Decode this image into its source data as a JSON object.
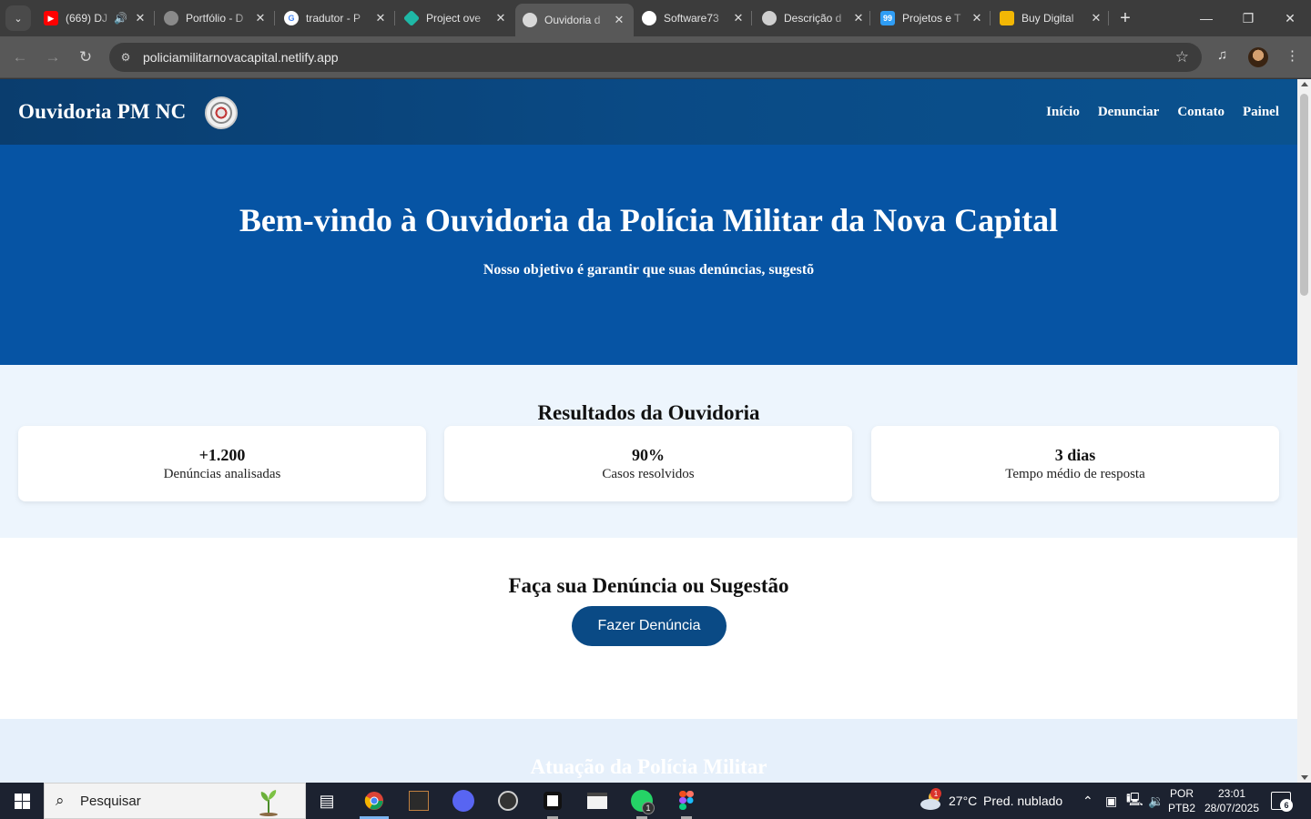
{
  "browser": {
    "tabs": [
      {
        "title": "(669) DJ",
        "favicon": "youtube-icon",
        "color": "#ff0000",
        "audio": true
      },
      {
        "title": "Portfólio - D",
        "favicon": "globe-icon",
        "color": "#8a8a8a"
      },
      {
        "title": "tradutor - P",
        "favicon": "google-icon",
        "color": "#ffffff"
      },
      {
        "title": "Project ove",
        "favicon": "diamond-icon",
        "color": "#1fb8a6"
      },
      {
        "title": "Ouvidoria d",
        "favicon": "police-badge-icon",
        "color": "#d8d8d8",
        "active": true
      },
      {
        "title": "Software73",
        "favicon": "github-icon",
        "color": "#ffffff"
      },
      {
        "title": "Descrição d",
        "favicon": "openai-icon",
        "color": "#cfcfcf"
      },
      {
        "title": "Projetos e T",
        "favicon": "99-icon",
        "color": "#2f9df5"
      },
      {
        "title": "Buy Digital",
        "favicon": "store-icon",
        "color": "#f2b705"
      }
    ],
    "url": "policiamilitarnovacapital.netlify.app"
  },
  "site": {
    "brand": "Ouvidoria PM NC",
    "nav": [
      "Início",
      "Denunciar",
      "Contato",
      "Painel"
    ],
    "hero": {
      "title": "Bem-vindo à Ouvidoria da Polícia Militar da Nova Capital",
      "subtitle": "Nosso objetivo é garantir que suas denúncias, sugestõ"
    },
    "results": {
      "title": "Resultados da Ouvidoria",
      "cards": [
        {
          "value": "+1.200",
          "label": "Denúncias analisadas"
        },
        {
          "value": "90%",
          "label": "Casos resolvidos"
        },
        {
          "value": "3 dias",
          "label": "Tempo médio de resposta"
        }
      ]
    },
    "cta": {
      "title": "Faça sua Denúncia ou Sugestão",
      "button": "Fazer Denúncia"
    },
    "next_section": {
      "title": "Atuação da Polícia Militar"
    },
    "colors": {
      "header": "#0a4a85",
      "hero": "#0654a4",
      "results_bg": "#edf5fd",
      "button": "#0a4a85"
    }
  },
  "taskbar": {
    "search_placeholder": "Pesquisar",
    "apps": [
      "task-view-icon",
      "chrome-icon",
      "terminal-icon",
      "discord-icon",
      "obs-icon",
      "capcut-icon",
      "terminal-window-icon",
      "whatsapp-icon",
      "figma-icon"
    ],
    "whatsapp_badge": "1",
    "weather": {
      "temp": "27°C",
      "condition": "Pred. nublado",
      "badge": "1"
    },
    "language": {
      "line1": "POR",
      "line2": "PTB2"
    },
    "clock": {
      "time": "23:01",
      "date": "28/07/2025"
    },
    "notifications": "6"
  }
}
